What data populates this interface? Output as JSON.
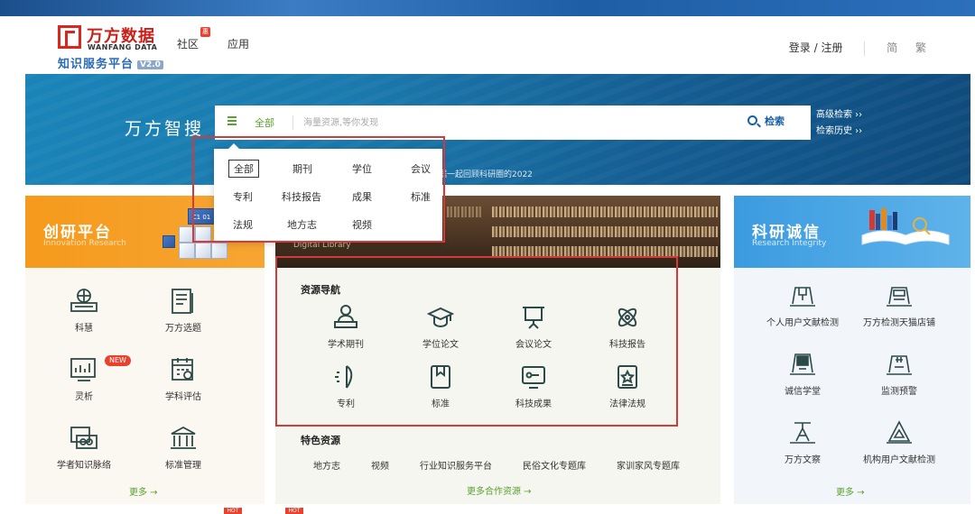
{
  "header": {
    "brand_name": "万方数据",
    "brand_en": "WANFANG DATA",
    "brand_sub": "知识服务平台",
    "brand_version": "V2.0",
    "nav": [
      {
        "label": "社区"
      },
      {
        "label": "应用"
      }
    ],
    "nav_badge": "惠",
    "login_label": "登录 / 注册",
    "lang_simplified": "简",
    "lang_traditional": "繁"
  },
  "search": {
    "title": "万方智搜",
    "scope": "全部",
    "placeholder": "海量资源,等你发现",
    "button_label": "检索",
    "advanced_label": "高级检索 ››",
    "history_label": "检索历史 ››",
    "caption": "方数据一起回顾科研圈的2022"
  },
  "dropdown": {
    "items": [
      "全部",
      "期刊",
      "学位",
      "会议",
      "专利",
      "科技报告",
      "成果",
      "标准",
      "法规",
      "地方志",
      "视频"
    ]
  },
  "left_panel": {
    "title": "创研平台",
    "subtitle": "Innovation Research",
    "cube_label": "C1 01",
    "items": [
      {
        "label": "科慧",
        "icon": "keyboard-icon"
      },
      {
        "label": "万方选题",
        "icon": "document-icon"
      },
      {
        "label": "灵析",
        "icon": "analytics-icon"
      },
      {
        "label": "学科评估",
        "icon": "calendar-check-icon"
      },
      {
        "label": "学者知识脉络",
        "icon": "scholar-card-icon"
      },
      {
        "label": "标准管理",
        "icon": "building-icon"
      }
    ],
    "new_badge": "NEW",
    "more": "更多 →"
  },
  "center_panel": {
    "image_caption": "Digital Library",
    "nav_title": "资源导航",
    "nav_items": [
      {
        "label": "学术期刊",
        "icon": "person-desk-icon"
      },
      {
        "label": "学位论文",
        "icon": "graduation-cap-icon"
      },
      {
        "label": "会议论文",
        "icon": "presentation-board-icon"
      },
      {
        "label": "科技报告",
        "icon": "atom-icon"
      },
      {
        "label": "专利",
        "icon": "patent-leaf-icon"
      },
      {
        "label": "标准",
        "icon": "bookmark-icon"
      },
      {
        "label": "科技成果",
        "icon": "achievement-screen-icon"
      },
      {
        "label": "法律法规",
        "icon": "star-document-icon"
      }
    ],
    "special_title": "特色资源",
    "special_items": [
      "地方志",
      "视频",
      "行业知识服务平台",
      "民俗文化专题库",
      "家训家风专题库"
    ],
    "more_partners": "更多合作资源 →"
  },
  "right_panel": {
    "title": "科研诚信",
    "subtitle": "Research Integrity",
    "items": [
      {
        "label": "个人用户文献检测",
        "icon": "document-check-icon"
      },
      {
        "label": "万方检测天猫店铺",
        "icon": "shop-icon"
      },
      {
        "label": "诚信学堂",
        "icon": "classroom-icon"
      },
      {
        "label": "监测预警",
        "icon": "warning-monitor-icon"
      },
      {
        "label": "万方文察",
        "icon": "telescope-icon"
      },
      {
        "label": "机构用户文献检测",
        "icon": "institution-check-icon"
      }
    ],
    "more": "更多 →"
  },
  "badges": {
    "hot": "HOT"
  },
  "colors": {
    "accent_green": "#5aa12f",
    "brand_red": "#c8201a",
    "left_orange": "#f59a1c",
    "right_blue": "#3b9be0",
    "icon_dark": "#2d4a4a",
    "highlight_red": "#d33a3a"
  }
}
